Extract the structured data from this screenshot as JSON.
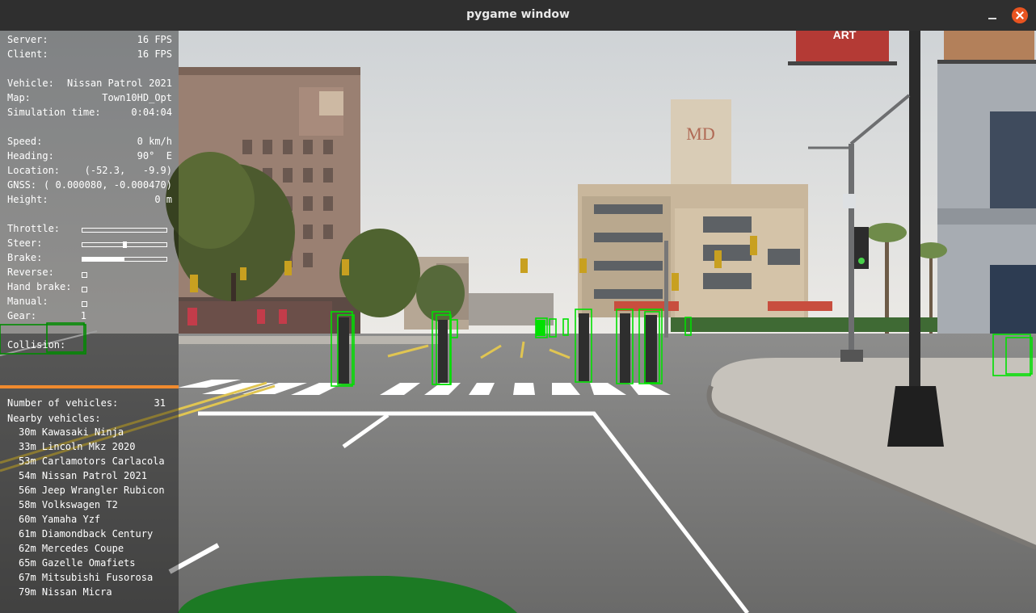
{
  "window": {
    "title": "pygame window"
  },
  "hud": {
    "server_label": "Server:",
    "server_value": "16 FPS",
    "client_label": "Client:",
    "client_value": "16 FPS",
    "vehicle_label": "Vehicle:",
    "vehicle_value": "Nissan Patrol 2021",
    "map_label": "Map:",
    "map_value": "Town10HD_Opt",
    "simtime_label": "Simulation time:",
    "simtime_value": "0:04:04",
    "speed_label": "Speed:",
    "speed_value": "0 km/h",
    "heading_label": "Heading:",
    "heading_value": "90°  E",
    "location_label": "Location:",
    "location_value": "(-52.3,   -9.9)",
    "gnss_label": "GNSS:",
    "gnss_value": "( 0.000080, -0.000470)",
    "height_label": "Height:",
    "height_value": "0 m",
    "throttle_label": "Throttle:",
    "throttle_fraction": 0,
    "steer_label": "Steer:",
    "steer_value": 0.0,
    "brake_label": "Brake:",
    "brake_fraction": 0.5,
    "reverse_label": "Reverse:",
    "reverse_checked": false,
    "handbrake_label": "Hand brake:",
    "handbrake_checked": false,
    "manual_label": "Manual:",
    "manual_checked": false,
    "gear_label": "Gear:",
    "gear_value": "1",
    "collision_label": "Collision:",
    "num_vehicles_label": "Number of vehicles:",
    "num_vehicles_value": "31",
    "nearby_label": "Nearby vehicles:",
    "nearby": [
      "30m Kawasaki Ninja",
      "33m Lincoln Mkz 2020",
      "53m Carlamotors Carlacola",
      "54m Nissan Patrol 2021",
      "56m Jeep Wrangler Rubicon",
      "58m Volkswagen T2",
      "60m Yamaha Yzf",
      "61m Diamondback Century",
      "62m Mercedes Coupe",
      "65m Gazelle Omafiets",
      "67m Mitsubishi Fusorosa",
      "79m Nissan Micra"
    ]
  },
  "scene": {
    "banner_left": "ART",
    "building_sign": "MD",
    "detection_color": "#00e000"
  }
}
